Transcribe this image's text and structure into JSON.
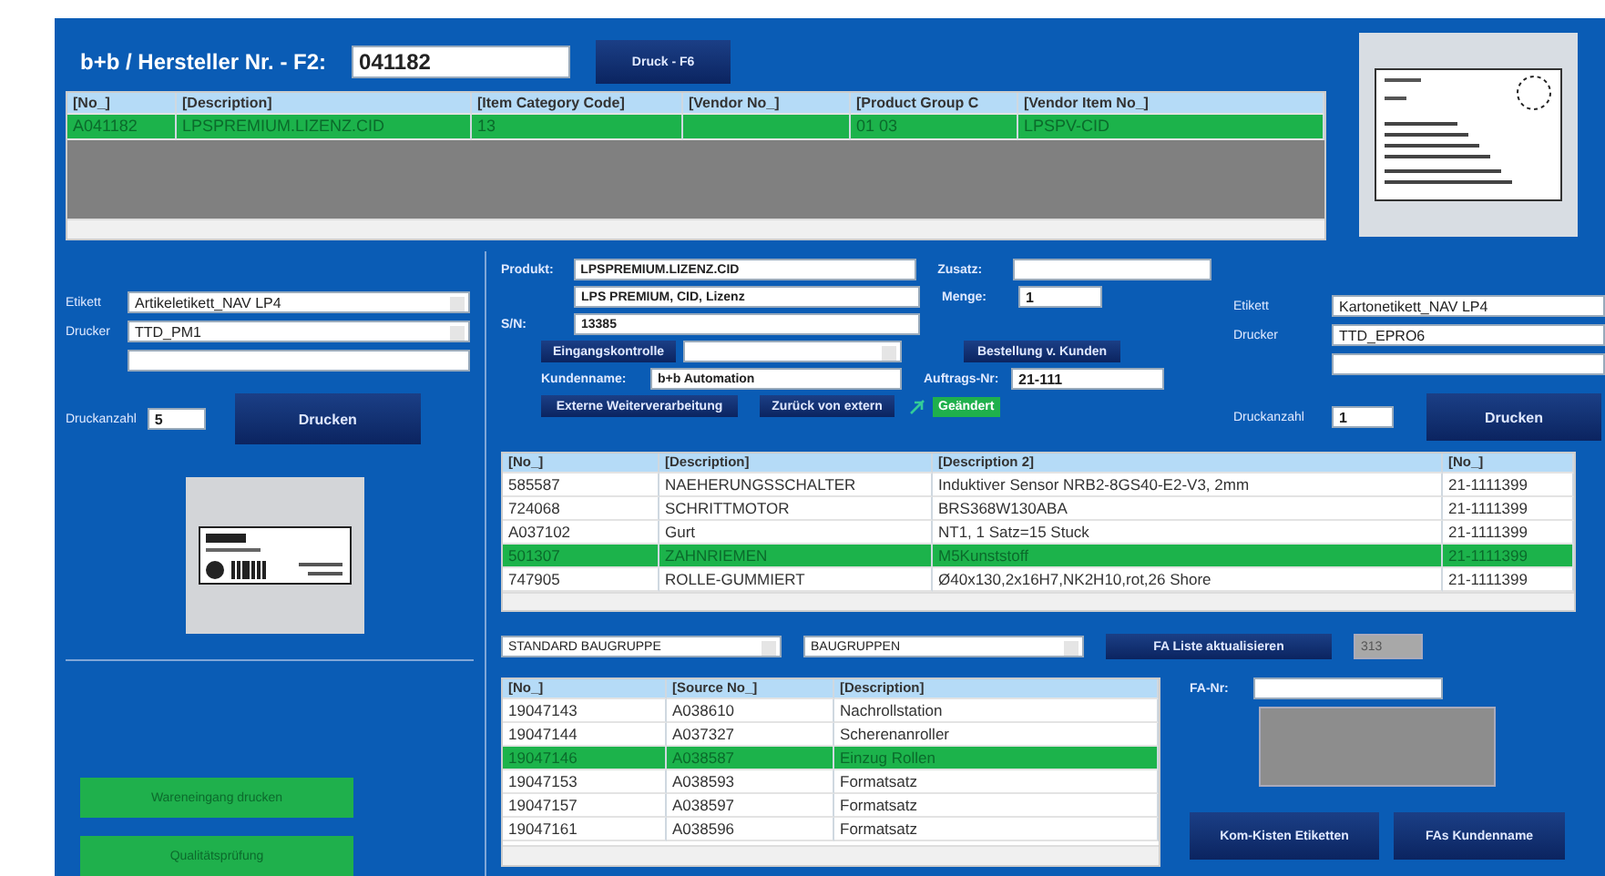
{
  "header": {
    "label": "b+b / Hersteller Nr. - F2:",
    "value": "041182",
    "print_button": "Druck - F6"
  },
  "item_table": {
    "columns": [
      "[No_]",
      "[Description]",
      "[Item Category Code]",
      "[Vendor No_]",
      "[Product Group C",
      "[Vendor Item No_]"
    ],
    "rows": [
      {
        "cells": [
          "A041182",
          "LPSPREMIUM.LIZENZ.CID",
          "13",
          "",
          "01 03",
          "LPSPV-CID"
        ],
        "selected": true
      }
    ]
  },
  "left_panel": {
    "etikett_label": "Etikett",
    "etikett": "Artikeletikett_NAV LP4",
    "drucker_label": "Drucker",
    "drucker": "TTD_PM1",
    "druckanzahl_label": "Druckanzahl",
    "druckanzahl": "5",
    "print_button": "Drucken",
    "actions": [
      "Wareneingang drucken",
      "Qualitätsprüfung"
    ]
  },
  "form": {
    "produkt_label": "Produkt:",
    "produkt": "LPSPREMIUM.LIZENZ.CID",
    "produkt_text": "LPS PREMIUM, CID, Lizenz",
    "sn_label": "S/N:",
    "sn": "13385",
    "zusatz_label": "Zusatz:",
    "menge_label": "Menge:",
    "menge": "1",
    "eingang_button": "Eingangskontrolle",
    "bestellung_button": "Bestellung v. Kunden",
    "kundenname_label": "Kundenname:",
    "kundenname": "b+b Automation",
    "auftrag_label": "Auftrags-Nr:",
    "auftrag": "21-111",
    "extern_button": "Externe Weiterverarbeitung",
    "zurueck_button": "Zurück von extern",
    "status_badge": "Geändert"
  },
  "right_panel": {
    "etikett_label": "Etikett",
    "etikett": "Kartonetikett_NAV LP4",
    "drucker_label": "Drucker",
    "drucker": "TTD_EPRO6",
    "druckanzahl_label": "Druckanzahl",
    "druckanzahl": "1",
    "print_button": "Drucken"
  },
  "parts_table": {
    "columns": [
      "[No_]",
      "[Description]",
      "[Description 2]",
      "[No_]"
    ],
    "rows": [
      {
        "cells": [
          "585587",
          "NAEHERUNGSSCHALTER",
          "Induktiver Sensor NRB2-8GS40-E2-V3, 2mm",
          "21-1111399"
        ],
        "selected": false
      },
      {
        "cells": [
          "724068",
          "SCHRITTMOTOR",
          "BRS368W130ABA",
          "21-1111399"
        ],
        "selected": false
      },
      {
        "cells": [
          "A037102",
          "Gurt",
          "NT1, 1 Satz=15 Stuck",
          "21-1111399"
        ],
        "selected": false
      },
      {
        "cells": [
          "501307",
          "ZAHNRIEMEN",
          "M5Kunststoff",
          "21-1111399"
        ],
        "selected": true
      },
      {
        "cells": [
          "747905",
          "ROLLE-GUMMIERT",
          "Ø40x130,2x16H7,NK2H10,rot,26 Shore",
          "21-1111399"
        ],
        "selected": false
      }
    ]
  },
  "filters": {
    "group": "STANDARD BAUGRUPPE",
    "type": "BAUGRUPPEN",
    "refresh_button": "FA Liste aktualisieren",
    "count": "313"
  },
  "fa_table": {
    "columns": [
      "[No_]",
      "[Source No_]",
      "[Description]"
    ],
    "rows": [
      {
        "cells": [
          "19047143",
          "A038610",
          "Nachrollstation"
        ],
        "selected": false
      },
      {
        "cells": [
          "19047144",
          "A037327",
          "Scherenanroller"
        ],
        "selected": false
      },
      {
        "cells": [
          "19047146",
          "A038587",
          "Einzug Rollen"
        ],
        "selected": true
      },
      {
        "cells": [
          "19047153",
          "A038593",
          "Formatsatz"
        ],
        "selected": false
      },
      {
        "cells": [
          "19047157",
          "A038597",
          "Formatsatz"
        ],
        "selected": false
      },
      {
        "cells": [
          "19047161",
          "A038596",
          "Formatsatz"
        ],
        "selected": false
      }
    ]
  },
  "fa": {
    "label": "FA-Nr:",
    "kisten_button": "Kom-Kisten Etiketten",
    "kunden_button": "FAs Kundenname"
  }
}
